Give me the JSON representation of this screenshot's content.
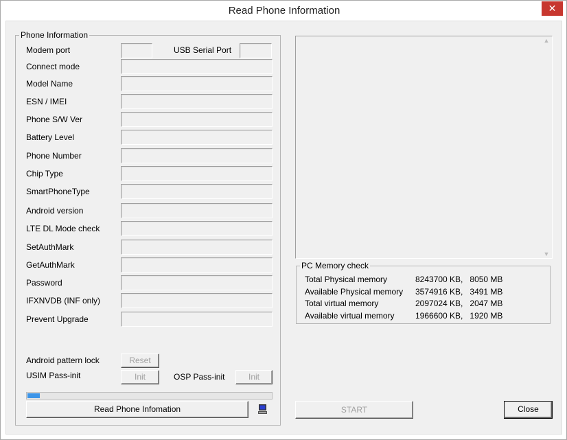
{
  "window": {
    "title": "Read Phone Information",
    "close_glyph": "✕"
  },
  "phone_info": {
    "legend": "Phone Information",
    "modem_port_label": "Modem port",
    "modem_port_value": "",
    "usb_serial_label": "USB Serial Port",
    "usb_serial_value": "",
    "fields": [
      {
        "label": "Connect mode",
        "value": ""
      },
      {
        "label": "Model Name",
        "value": ""
      },
      {
        "label": "ESN / IMEI",
        "value": ""
      },
      {
        "label": "Phone S/W Ver",
        "value": ""
      },
      {
        "label": "Battery Level",
        "value": ""
      },
      {
        "label": "Phone Number",
        "value": ""
      },
      {
        "label": "Chip Type",
        "value": ""
      },
      {
        "label": "SmartPhoneType",
        "value": ""
      },
      {
        "label": "Android version",
        "value": ""
      },
      {
        "label": "LTE DL Mode check",
        "value": ""
      },
      {
        "label": "SetAuthMark",
        "value": ""
      },
      {
        "label": "GetAuthMark",
        "value": ""
      },
      {
        "label": "Password",
        "value": ""
      },
      {
        "label": "IFXNVDB (INF only)",
        "value": ""
      },
      {
        "label": "Prevent Upgrade",
        "value": ""
      }
    ],
    "pattern_lock_label": "Android pattern lock",
    "reset_button": "Reset",
    "usim_label": "USIM Pass-init",
    "usim_button": "Init",
    "osp_label": "OSP Pass-init",
    "osp_button": "Init",
    "progress_percent": 5,
    "read_button": "Read Phone Infomation"
  },
  "memory": {
    "legend": "PC Memory check",
    "rows": [
      {
        "label": "Total Physical memory",
        "value": "8243700 KB,   8050 MB"
      },
      {
        "label": "Available Physical memory",
        "value": "3574916 KB,   3491 MB"
      },
      {
        "label": "Total virtual memory",
        "value": "2097024 KB,   2047 MB"
      },
      {
        "label": "Available virtual memory",
        "value": "1966600 KB,   1920 MB"
      }
    ]
  },
  "log_text": "",
  "start_button": "START",
  "close_button": "Close",
  "colors": {
    "progress": "#3d95e8",
    "close_red": "#c7372f"
  }
}
